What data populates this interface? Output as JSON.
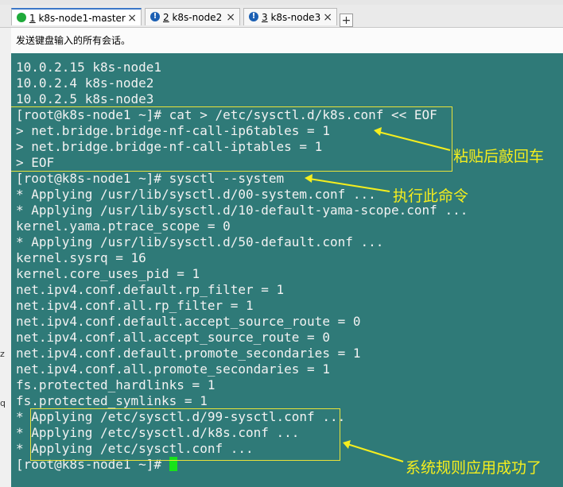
{
  "tabs": [
    {
      "index": "1",
      "label": " k8s-node1-master",
      "status": "connected"
    },
    {
      "index": "2",
      "label": " k8s-node2",
      "status": "warning"
    },
    {
      "index": "3",
      "label": " k8s-node3",
      "status": "warning"
    }
  ],
  "new_tab": "+",
  "close_glyph": "×",
  "warning_glyph": "!",
  "broadcast_banner": "发送键盘输入的所有会话。",
  "gutter_marks": [
    "z",
    "q"
  ],
  "terminal": {
    "lines": [
      "10.0.2.15 k8s-node1",
      "10.0.2.4 k8s-node2",
      "10.0.2.5 k8s-node3",
      "[root@k8s-node1 ~]# cat > /etc/sysctl.d/k8s.conf << EOF",
      "> net.bridge.bridge-nf-call-ip6tables = 1",
      "> net.bridge.bridge-nf-call-iptables = 1",
      "> EOF",
      "[root@k8s-node1 ~]# sysctl --system",
      "* Applying /usr/lib/sysctl.d/00-system.conf ...",
      "* Applying /usr/lib/sysctl.d/10-default-yama-scope.conf ...",
      "kernel.yama.ptrace_scope = 0",
      "* Applying /usr/lib/sysctl.d/50-default.conf ...",
      "kernel.sysrq = 16",
      "kernel.core_uses_pid = 1",
      "net.ipv4.conf.default.rp_filter = 1",
      "net.ipv4.conf.all.rp_filter = 1",
      "net.ipv4.conf.default.accept_source_route = 0",
      "net.ipv4.conf.all.accept_source_route = 0",
      "net.ipv4.conf.default.promote_secondaries = 1",
      "net.ipv4.conf.all.promote_secondaries = 1",
      "fs.protected_hardlinks = 1",
      "fs.protected_symlinks = 1",
      "* Applying /etc/sysctl.d/99-sysctl.conf ...",
      "* Applying /etc/sysctl.d/k8s.conf ...",
      "* Applying /etc/sysctl.conf ..."
    ],
    "prompt": "[root@k8s-node1 ~]# "
  },
  "annotations": {
    "paste_enter": "粘贴后敲回车",
    "run_command": "执行此命令",
    "success": "系统规则应用成功了"
  },
  "colors": {
    "terminal_bg": "#2f7a78",
    "terminal_fg": "#f2f2f2",
    "annotation": "#f5ee1e",
    "cursor": "#18e21a",
    "connected": "#1faa3a",
    "warning": "#1b5fb3"
  }
}
